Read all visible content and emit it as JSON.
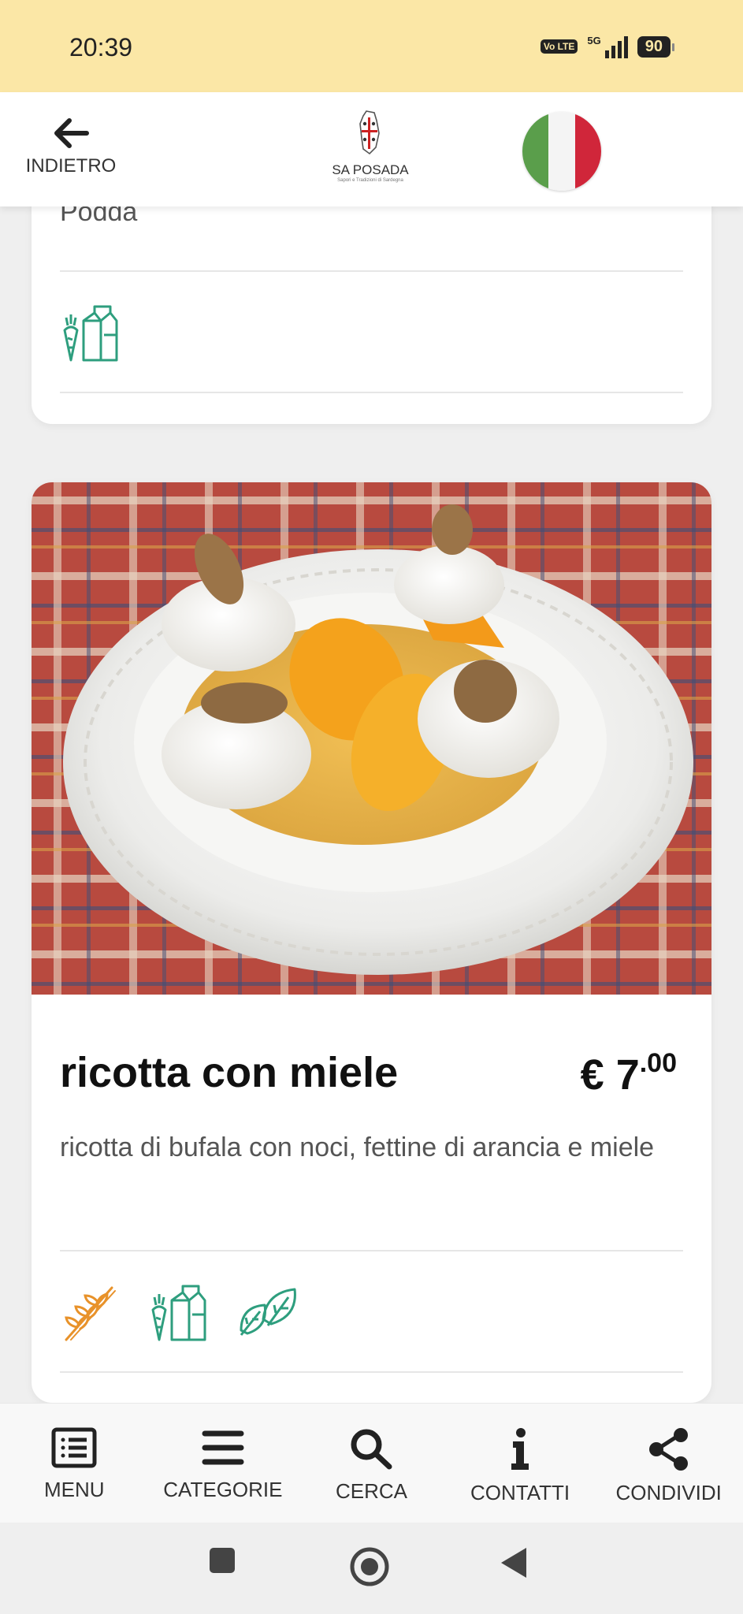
{
  "status_bar": {
    "time": "20:39",
    "volte": "Vo LTE",
    "network": "5G",
    "battery": "90"
  },
  "header": {
    "back_label": "INDIETRO",
    "logo_text": "SA POSADA",
    "logo_subtitle": "Sapori e Tradizioni di Sardegna",
    "language_flag": "italian-flag"
  },
  "previous_item": {
    "subtitle_fragment": "Podda",
    "icons": [
      "vegetarian-icon"
    ]
  },
  "item": {
    "title": "ricotta con miele",
    "price_currency": "€",
    "price_int": "7",
    "price_dec": ".00",
    "description": "ricotta di bufala con noci, fettine di arancia e miele",
    "icons": [
      "gluten-icon",
      "vegetarian-icon",
      "vegan-icon"
    ]
  },
  "bottom_nav": {
    "items": [
      {
        "label": "MENU",
        "icon": "menu-list-icon"
      },
      {
        "label": "CATEGORIE",
        "icon": "hamburger-icon"
      },
      {
        "label": "CERCA",
        "icon": "search-icon"
      },
      {
        "label": "CONTATTI",
        "icon": "info-icon"
      },
      {
        "label": "CONDIVIDI",
        "icon": "share-icon"
      }
    ]
  },
  "colors": {
    "status_bg": "#fbe7a6",
    "green_icon": "#2e9e7e",
    "orange_icon": "#e8922a"
  }
}
